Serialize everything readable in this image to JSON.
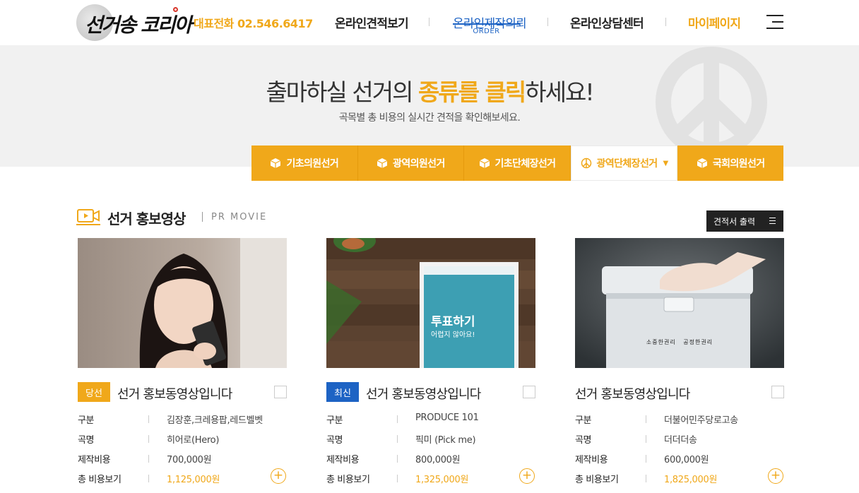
{
  "header": {
    "logo_text": "선거송 코리아",
    "phone": "대표전화 02.546.6417",
    "nav": [
      {
        "label": "온라인견적보기"
      },
      {
        "label": "온라인제작의뢰",
        "sub": "ORDER"
      },
      {
        "label": "온라인상담센터"
      },
      {
        "label": "마이페이지"
      }
    ]
  },
  "banner": {
    "title_pre": "출마하실 선거의 ",
    "title_highlight": "종류를 클릭",
    "title_post": "하세요!",
    "subtitle": "곡목별 총 비용의 실시간 견적을 확인해보세요."
  },
  "tabs": [
    "기초의원선거",
    "광역의원선거",
    "기초단체장선거",
    "광역단체장선거",
    "국회의원선거"
  ],
  "section": {
    "title": "선거 홍보영상",
    "subtitle_en": "PR MOVIE",
    "quote_button": "견적서 출력"
  },
  "labels": {
    "category": "구분",
    "song": "곡명",
    "production_cost": "제작비용",
    "total_cost": "총 비용보기"
  },
  "cards": [
    {
      "badge": "당선",
      "title": "선거 홍보동영상입니다",
      "category": "김장훈,크레용팝,레드벨벳",
      "song": "히어로(Hero)",
      "production_cost": "700,000원",
      "total_cost": "1,125,000원"
    },
    {
      "badge": "최신",
      "title": "선거 홍보동영상입니다",
      "category": "PRODUCE 101",
      "song": "픽미 (Pick me)",
      "production_cost": "800,000원",
      "total_cost": "1,325,000원",
      "thumb_card_title": "투표하기",
      "thumb_card_sub": "어렵지 않아요!"
    },
    {
      "badge": "",
      "title": "선거 홍보동영상입니다",
      "category": "더불어민주당로고송",
      "song": "더더더송",
      "production_cost": "600,000원",
      "total_cost": "1,825,000원",
      "thumb_box_text": "소중한권리   공정한권리"
    }
  ],
  "colors": {
    "accent": "#f0a81a",
    "blue": "#1d63c4",
    "dark": "#222222"
  }
}
